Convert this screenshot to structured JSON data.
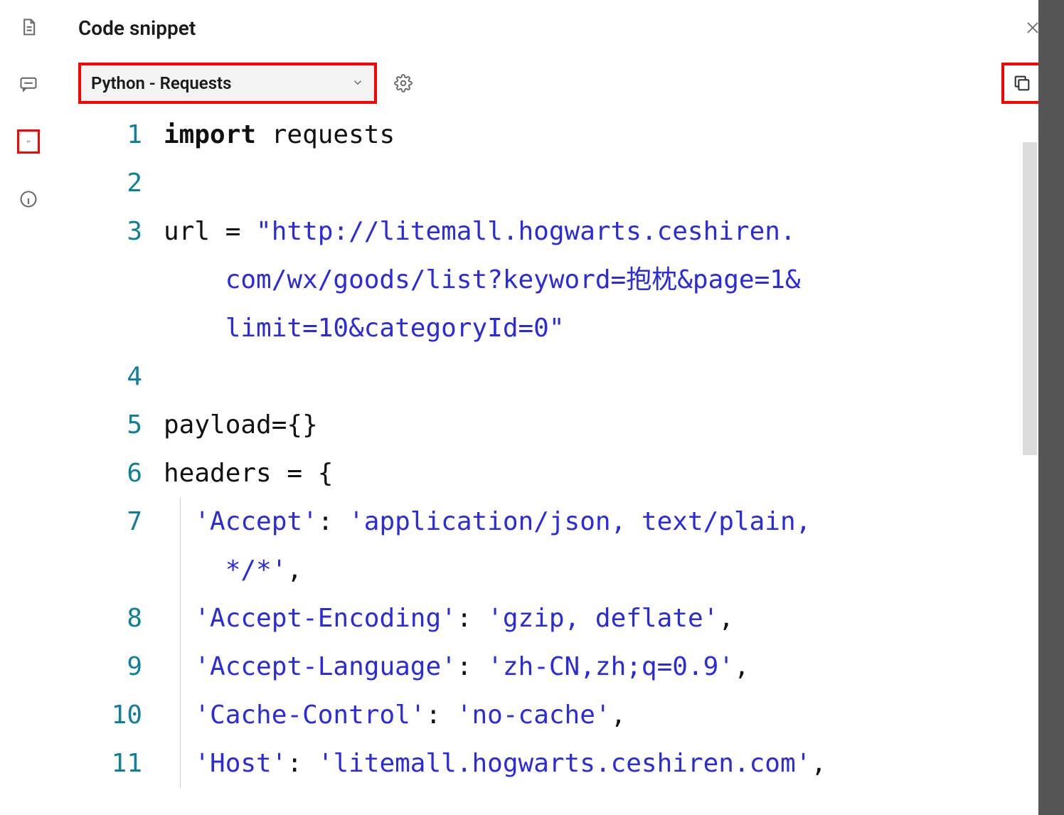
{
  "header": {
    "title": "Code snippet"
  },
  "sidebar": {
    "icons": [
      {
        "name": "document-icon"
      },
      {
        "name": "comment-icon"
      },
      {
        "name": "code-icon",
        "highlighted": true
      },
      {
        "name": "info-icon"
      }
    ]
  },
  "toolbar": {
    "language_selected": "Python - Requests"
  },
  "code": {
    "lines": [
      {
        "n": 1,
        "segments": [
          {
            "t": "import",
            "c": "kw"
          },
          {
            "t": " requests",
            "c": "op"
          }
        ]
      },
      {
        "n": 2,
        "segments": []
      },
      {
        "n": 3,
        "segments": [
          {
            "t": "url = ",
            "c": "op"
          },
          {
            "t": "\"http://litemall.hogwarts.ceshiren.",
            "c": "str"
          }
        ]
      },
      {
        "n": null,
        "cont": true,
        "segments": [
          {
            "t": "    com/wx/goods/list?keyword=抱枕&page=1&",
            "c": "str"
          }
        ]
      },
      {
        "n": null,
        "cont": true,
        "segments": [
          {
            "t": "    limit=10&categoryId=0\"",
            "c": "str"
          }
        ]
      },
      {
        "n": 4,
        "segments": []
      },
      {
        "n": 5,
        "segments": [
          {
            "t": "payload={}",
            "c": "op"
          }
        ]
      },
      {
        "n": 6,
        "segments": [
          {
            "t": "headers = {",
            "c": "op"
          }
        ]
      },
      {
        "n": 7,
        "indent": true,
        "segments": [
          {
            "t": "  ",
            "c": "op"
          },
          {
            "t": "'Accept'",
            "c": "str"
          },
          {
            "t": ": ",
            "c": "op"
          },
          {
            "t": "'application/json, text/plain, ",
            "c": "str"
          }
        ]
      },
      {
        "n": null,
        "cont": true,
        "indent": true,
        "segments": [
          {
            "t": "    */*'",
            "c": "str"
          },
          {
            "t": ",",
            "c": "op"
          }
        ]
      },
      {
        "n": 8,
        "indent": true,
        "segments": [
          {
            "t": "  ",
            "c": "op"
          },
          {
            "t": "'Accept-Encoding'",
            "c": "str"
          },
          {
            "t": ": ",
            "c": "op"
          },
          {
            "t": "'gzip, deflate'",
            "c": "str"
          },
          {
            "t": ",",
            "c": "op"
          }
        ]
      },
      {
        "n": 9,
        "indent": true,
        "segments": [
          {
            "t": "  ",
            "c": "op"
          },
          {
            "t": "'Accept-Language'",
            "c": "str"
          },
          {
            "t": ": ",
            "c": "op"
          },
          {
            "t": "'zh-CN,zh;q=0.9'",
            "c": "str"
          },
          {
            "t": ",",
            "c": "op"
          }
        ]
      },
      {
        "n": 10,
        "indent": true,
        "segments": [
          {
            "t": "  ",
            "c": "op"
          },
          {
            "t": "'Cache-Control'",
            "c": "str"
          },
          {
            "t": ": ",
            "c": "op"
          },
          {
            "t": "'no-cache'",
            "c": "str"
          },
          {
            "t": ",",
            "c": "op"
          }
        ]
      },
      {
        "n": 11,
        "indent": true,
        "segments": [
          {
            "t": "  ",
            "c": "op"
          },
          {
            "t": "'Host'",
            "c": "str"
          },
          {
            "t": ": ",
            "c": "op"
          },
          {
            "t": "'litemall.hogwarts.ceshiren.com'",
            "c": "str"
          },
          {
            "t": ",",
            "c": "op"
          }
        ]
      }
    ]
  }
}
